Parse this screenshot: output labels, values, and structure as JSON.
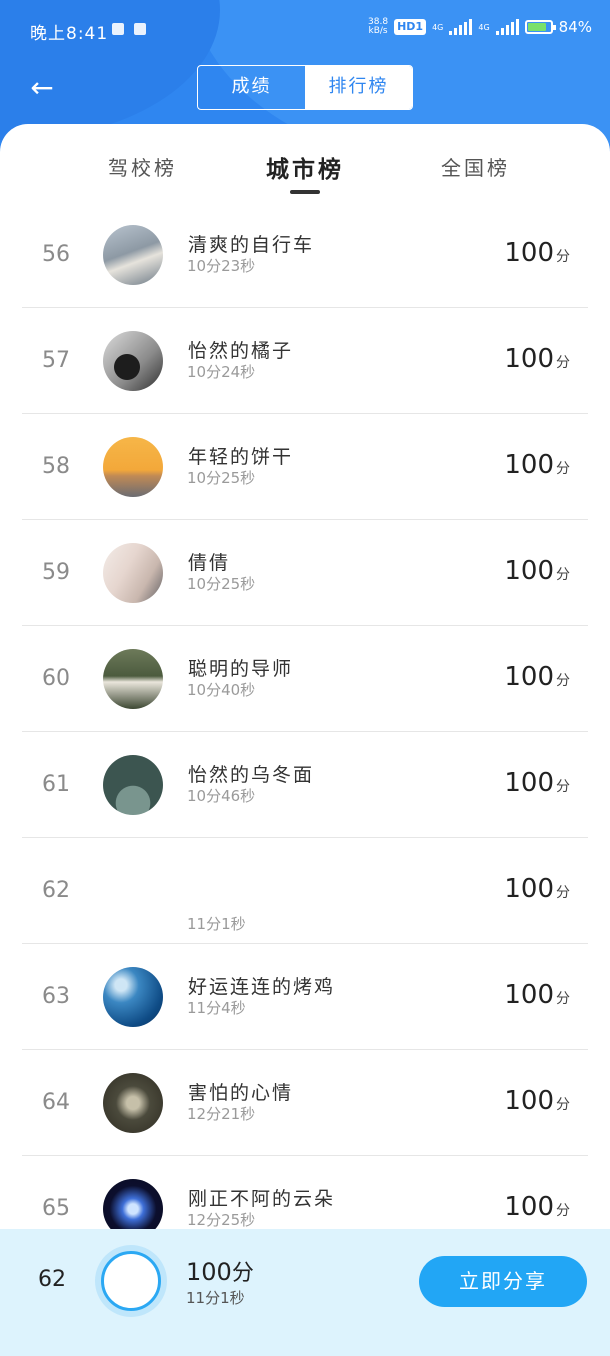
{
  "status_bar": {
    "time": "晚上8:41",
    "net_speed_value": "38.8",
    "net_speed_unit": "kB/s",
    "hd_badge": "HD1",
    "network_1": "4G",
    "network_2": "4G",
    "battery_percent": "84%"
  },
  "header": {
    "segment_tabs": [
      "成绩",
      "排行榜"
    ],
    "active_segment": "排行榜"
  },
  "tabs": {
    "items": [
      "驾校榜",
      "城市榜",
      "全国榜"
    ],
    "active": "城市榜"
  },
  "rows": [
    {
      "rank": "56",
      "name": "清爽的自行车",
      "time": "10分23秒",
      "score": "100",
      "unit": "分"
    },
    {
      "rank": "57",
      "name": "怡然的橘子",
      "time": "10分24秒",
      "score": "100",
      "unit": "分"
    },
    {
      "rank": "58",
      "name": "年轻的饼干",
      "time": "10分25秒",
      "score": "100",
      "unit": "分"
    },
    {
      "rank": "59",
      "name": "倩倩",
      "time": "10分25秒",
      "score": "100",
      "unit": "分"
    },
    {
      "rank": "60",
      "name": "聪明的导师",
      "time": "10分40秒",
      "score": "100",
      "unit": "分"
    },
    {
      "rank": "61",
      "name": "怡然的乌冬面",
      "time": "10分46秒",
      "score": "100",
      "unit": "分"
    },
    {
      "rank": "62",
      "name": "",
      "time": "11分1秒",
      "score": "100",
      "unit": "分"
    },
    {
      "rank": "63",
      "name": "好运连连的烤鸡",
      "time": "11分4秒",
      "score": "100",
      "unit": "分"
    },
    {
      "rank": "64",
      "name": "害怕的心情",
      "time": "12分21秒",
      "score": "100",
      "unit": "分"
    },
    {
      "rank": "65",
      "name": "刚正不阿的云朵",
      "time": "12分25秒",
      "score": "100",
      "unit": "分"
    }
  ],
  "my_entry": {
    "rank": "62",
    "score": "100",
    "unit": "分",
    "time": "11分1秒"
  },
  "share_button": "立即分享",
  "colors": {
    "header_blue": "#2f86f0",
    "share_blue": "#22a6f5",
    "bottom_bar_bg": "#ddf3fd"
  },
  "icons": {
    "back": "arrow-left-icon"
  }
}
